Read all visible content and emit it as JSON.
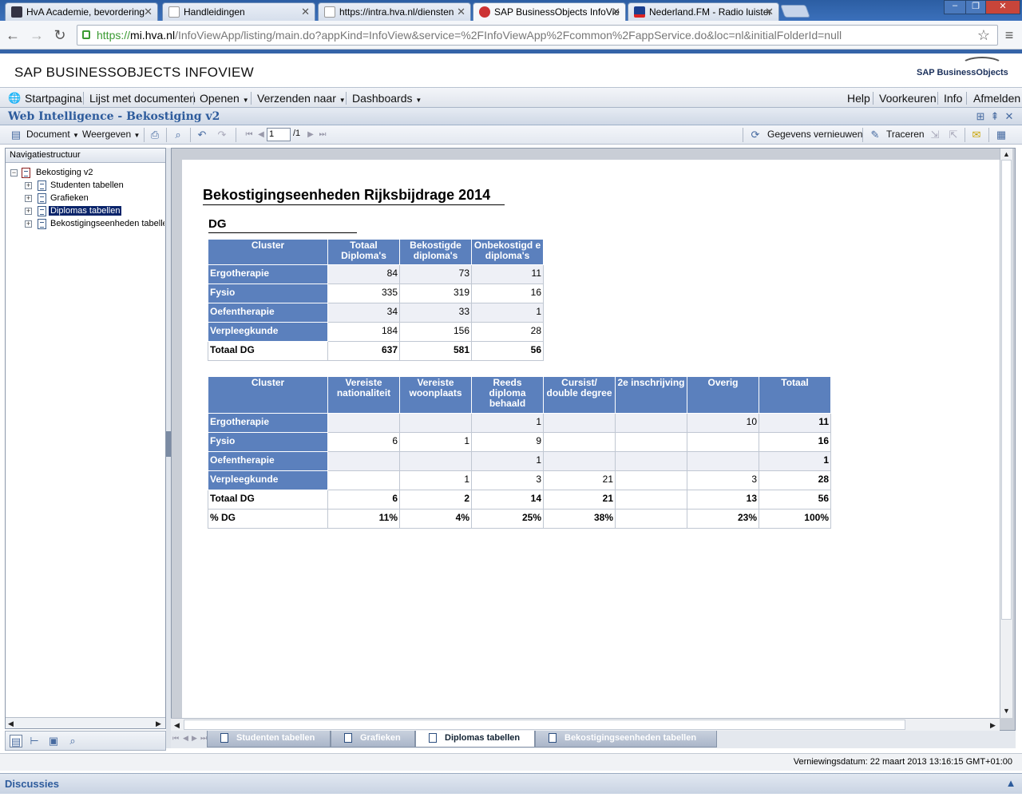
{
  "browser": {
    "tabs": [
      {
        "title": "HvA Academie, bevordering",
        "icon": "hva-icon"
      },
      {
        "title": "Handleidingen",
        "icon": "page-icon"
      },
      {
        "title": "https://intra.hva.nl/diensten",
        "icon": "page-icon"
      },
      {
        "title": "SAP BusinessObjects InfoVie",
        "icon": "sap-icon"
      },
      {
        "title": "Nederland.FM - Radio luister",
        "icon": "fm-icon"
      }
    ],
    "url_https": "https://",
    "url_host": "mi.hva.nl",
    "url_rest": "/InfoViewApp/listing/main.do?appKind=InfoView&service=%2FInfoViewApp%2Fcommon%2FappService.do&loc=nl&initialFolderId=null"
  },
  "app": {
    "title": "SAP BUSINESSOBJECTS INFOVIEW",
    "logo_text": "SAP BusinessObjects"
  },
  "menu": {
    "startpagina": "Startpagina",
    "lijst": "Lijst met documenten",
    "openen": "Openen",
    "verzenden": "Verzenden naar",
    "dashboards": "Dashboards",
    "help": "Help",
    "voorkeuren": "Voorkeuren",
    "info": "Info",
    "afmelden": "Afmelden"
  },
  "webi": {
    "title": "Web Intelligence - Bekostiging v2",
    "document": "Document",
    "weergeven": "Weergeven",
    "page_current": "1",
    "page_total": "/1",
    "refresh": "Gegevens vernieuwen",
    "trace": "Traceren"
  },
  "nav": {
    "header": "Navigatiestructuur",
    "root": "Bekostiging v2",
    "items": [
      "Studenten tabellen",
      "Grafieken",
      "Diplomas tabellen",
      "Bekostigingseenheden tabelle"
    ]
  },
  "report": {
    "title": "Bekostigingseenheden Rijksbijdrage 2014",
    "section": "DG",
    "table1": {
      "headers": [
        "Cluster",
        "Totaal Diploma's",
        "Bekostigde diploma's",
        "Onbekostigd e diploma's"
      ],
      "rows": [
        [
          "Ergotherapie",
          "84",
          "73",
          "11"
        ],
        [
          "Fysio",
          "335",
          "319",
          "16"
        ],
        [
          "Oefentherapie",
          "34",
          "33",
          "1"
        ],
        [
          "Verpleegkunde",
          "184",
          "156",
          "28"
        ]
      ],
      "total": [
        "Totaal DG",
        "637",
        "581",
        "56"
      ]
    },
    "table2": {
      "headers": [
        "Cluster",
        "Vereiste nationaliteit",
        "Vereiste woonplaats",
        "Reeds diploma behaald",
        "Cursist/ double degree",
        "2e inschrijving",
        "Overig",
        "Totaal"
      ],
      "rows": [
        [
          "Ergotherapie",
          "",
          "",
          "1",
          "",
          "",
          "10",
          "11"
        ],
        [
          "Fysio",
          "6",
          "1",
          "9",
          "",
          "",
          "",
          "16"
        ],
        [
          "Oefentherapie",
          "",
          "",
          "1",
          "",
          "",
          "",
          "1"
        ],
        [
          "Verpleegkunde",
          "",
          "1",
          "3",
          "21",
          "",
          "3",
          "28"
        ]
      ],
      "total": [
        "Totaal DG",
        "6",
        "2",
        "14",
        "21",
        "",
        "13",
        "56"
      ],
      "percent": [
        "% DG",
        "11%",
        "4%",
        "25%",
        "38%",
        "",
        "23%",
        "100%"
      ]
    }
  },
  "report_tabs": [
    "Studenten tabellen",
    "Grafieken",
    "Diplomas tabellen",
    "Bekostigingseenheden tabellen"
  ],
  "status": "Verniewingsdatum: 22 maart 2013 13:16:15 GMT+01:00",
  "discussions": "Discussies",
  "colors": {
    "header_blue": "#5b80bd",
    "title_blue": "#2d5b9c"
  }
}
